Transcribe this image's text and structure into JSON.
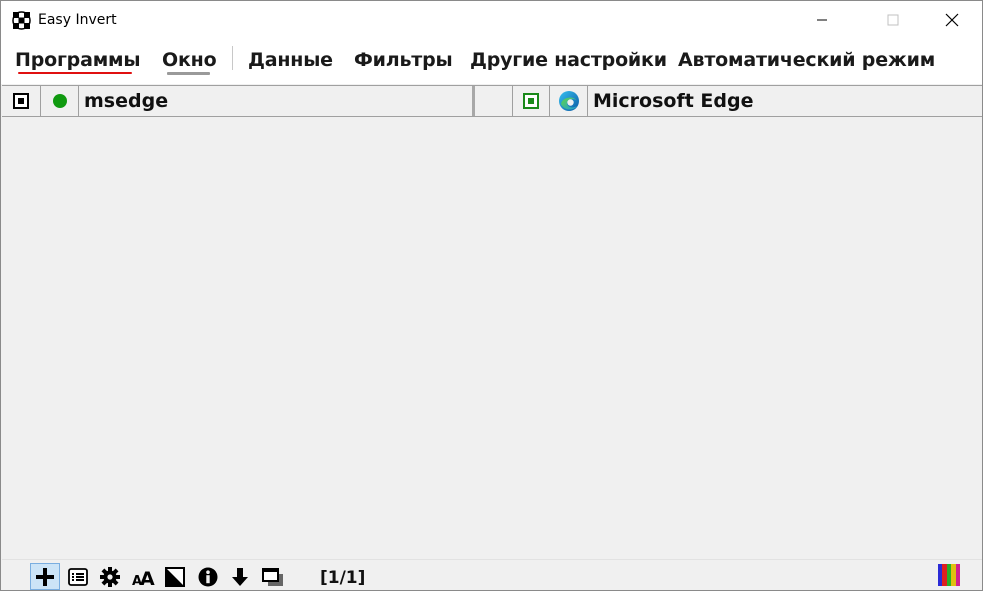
{
  "window": {
    "title": "Easy Invert",
    "minimize_icon": "minimize-icon",
    "maximize_icon": "maximize-icon",
    "close_icon": "close-icon"
  },
  "tabs": [
    {
      "label": "Программы",
      "active": true
    },
    {
      "label": "Окно",
      "active": false
    },
    {
      "label": "Данные",
      "active": false
    },
    {
      "label": "Фильтры",
      "active": false
    },
    {
      "label": "Другие настройки",
      "active": false
    },
    {
      "label": "Автоматический режим",
      "active": false
    }
  ],
  "list": {
    "rows": [
      {
        "left": {
          "checkbox": "checked",
          "status_icon": "green-dot-icon",
          "status_color": "#109a10",
          "name": "msedge"
        },
        "right": {
          "checkbox": "checked",
          "app_icon": "edge-icon",
          "name": "Microsoft Edge"
        }
      }
    ]
  },
  "toolbar": {
    "tools": [
      {
        "icon": "plus-icon",
        "active": true
      },
      {
        "icon": "list-icon",
        "active": false
      },
      {
        "icon": "gear-icon",
        "active": false
      },
      {
        "icon": "font-size-icon",
        "label": "AA",
        "active": false
      },
      {
        "icon": "contrast-icon",
        "active": false
      },
      {
        "icon": "info-icon",
        "active": false
      },
      {
        "icon": "arrow-down-icon",
        "active": false
      },
      {
        "icon": "window-shadow-icon",
        "active": false
      }
    ],
    "page_indicator": "[1/1]",
    "palette_colors": [
      "#2b2bd6",
      "#e02020",
      "#28b028",
      "#e0c010",
      "#d02090"
    ]
  },
  "colors": {
    "active_tab_underline": "#e01010",
    "inactive_tab_underline": "#9a9a9a",
    "background": "#f0f0f0"
  }
}
